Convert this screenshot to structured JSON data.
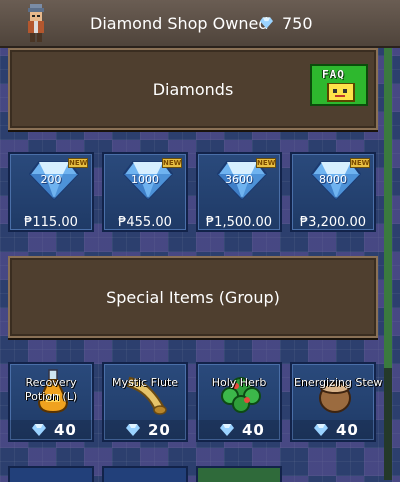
{
  "header": {
    "title": "Diamond Shop Owned",
    "diamonds_owned": "750",
    "avatar_icon": "pixel-character-avatar",
    "gem_icon": "diamond-icon"
  },
  "sections": {
    "diamonds": {
      "title": "Diamonds",
      "faq_label": "FAQ"
    },
    "special": {
      "title": "Special Items (Group)"
    }
  },
  "diamond_packs": [
    {
      "amount": "200",
      "price": "₱115.00",
      "badge": "NEW"
    },
    {
      "amount": "1000",
      "price": "₱455.00",
      "badge": "NEW"
    },
    {
      "amount": "3600",
      "price": "₱1,500.00",
      "badge": "NEW"
    },
    {
      "amount": "8000",
      "price": "₱3,200.00",
      "badge": "NEW"
    }
  ],
  "special_items": [
    {
      "name": "Recovery Potion (L)",
      "cost": "40",
      "icon": "potion-flask-icon"
    },
    {
      "name": "Mystic Flute",
      "cost": "20",
      "icon": "horn-flute-icon"
    },
    {
      "name": "Holy Herb",
      "cost": "40",
      "icon": "herb-plant-icon"
    },
    {
      "name": "Energizing Stew",
      "cost": "40",
      "icon": "stew-pot-icon"
    }
  ],
  "colors": {
    "accent_green": "#2eb82e",
    "panel_brown": "#4f3f2f",
    "card_blue": "#1f3a66",
    "gold": "#e8c043"
  }
}
